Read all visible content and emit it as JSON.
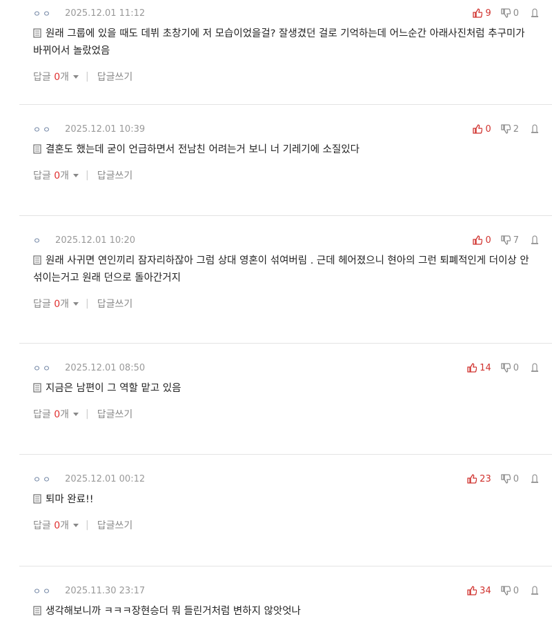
{
  "actions": {
    "reply_label": "답글",
    "count_suffix": "개",
    "write_label": "답글쓰기"
  },
  "comments": [
    {
      "nick": "ㅇㅇ",
      "date": "2025.12.01 11:12",
      "up": "9",
      "down": "0",
      "text": "원래 그룹에 있을 때도 데뷔 초창기에 저 모습이었을걸? 잘생겼던 걸로 기억하는데 어느순간 아래사진처럼 추구미가 바뀌어서 놀랐었음",
      "reply_count": "0"
    },
    {
      "nick": "ㅇㅇ",
      "date": "2025.12.01 10:39",
      "up": "0",
      "down": "2",
      "text": "결혼도 했는데 굳이 언급하면서 전남친 어려는거 보니 너 기레기에 소질있다",
      "reply_count": "0"
    },
    {
      "nick": "ㅇ",
      "date": "2025.12.01 10:20",
      "up": "0",
      "down": "7",
      "text": "원래 사귀면 연인끼리 잠자리하잖아 그럼 상대 영혼이 섞여버림 . 근데 헤어졌으니 현아의 그런 퇴폐적인게 더이상 안섞이는거고 원래 던으로 돌아간거지",
      "reply_count": "0"
    },
    {
      "nick": "ㅇㅇ",
      "date": "2025.12.01 08:50",
      "up": "14",
      "down": "0",
      "text": "지금은 남편이 그 역할 맡고 있음",
      "reply_count": "0"
    },
    {
      "nick": "ㅇㅇ",
      "date": "2025.12.01 00:12",
      "up": "23",
      "down": "0",
      "text": "퇴마 완료!!",
      "reply_count": "0"
    },
    {
      "nick": "ㅇㅇ",
      "date": "2025.11.30 23:17",
      "up": "34",
      "down": "0",
      "text": "생각해보니까 ㅋㅋㅋ장현승더 뭐 들린거처럼 변하지 않앗엇나",
      "reply_count": ""
    }
  ],
  "icons": {
    "up": "thumbs-up-icon",
    "down": "thumbs-down-icon",
    "report": "report-icon",
    "doc": "document-icon"
  },
  "colors": {
    "up": "#d0312d",
    "count": "#e03131"
  }
}
